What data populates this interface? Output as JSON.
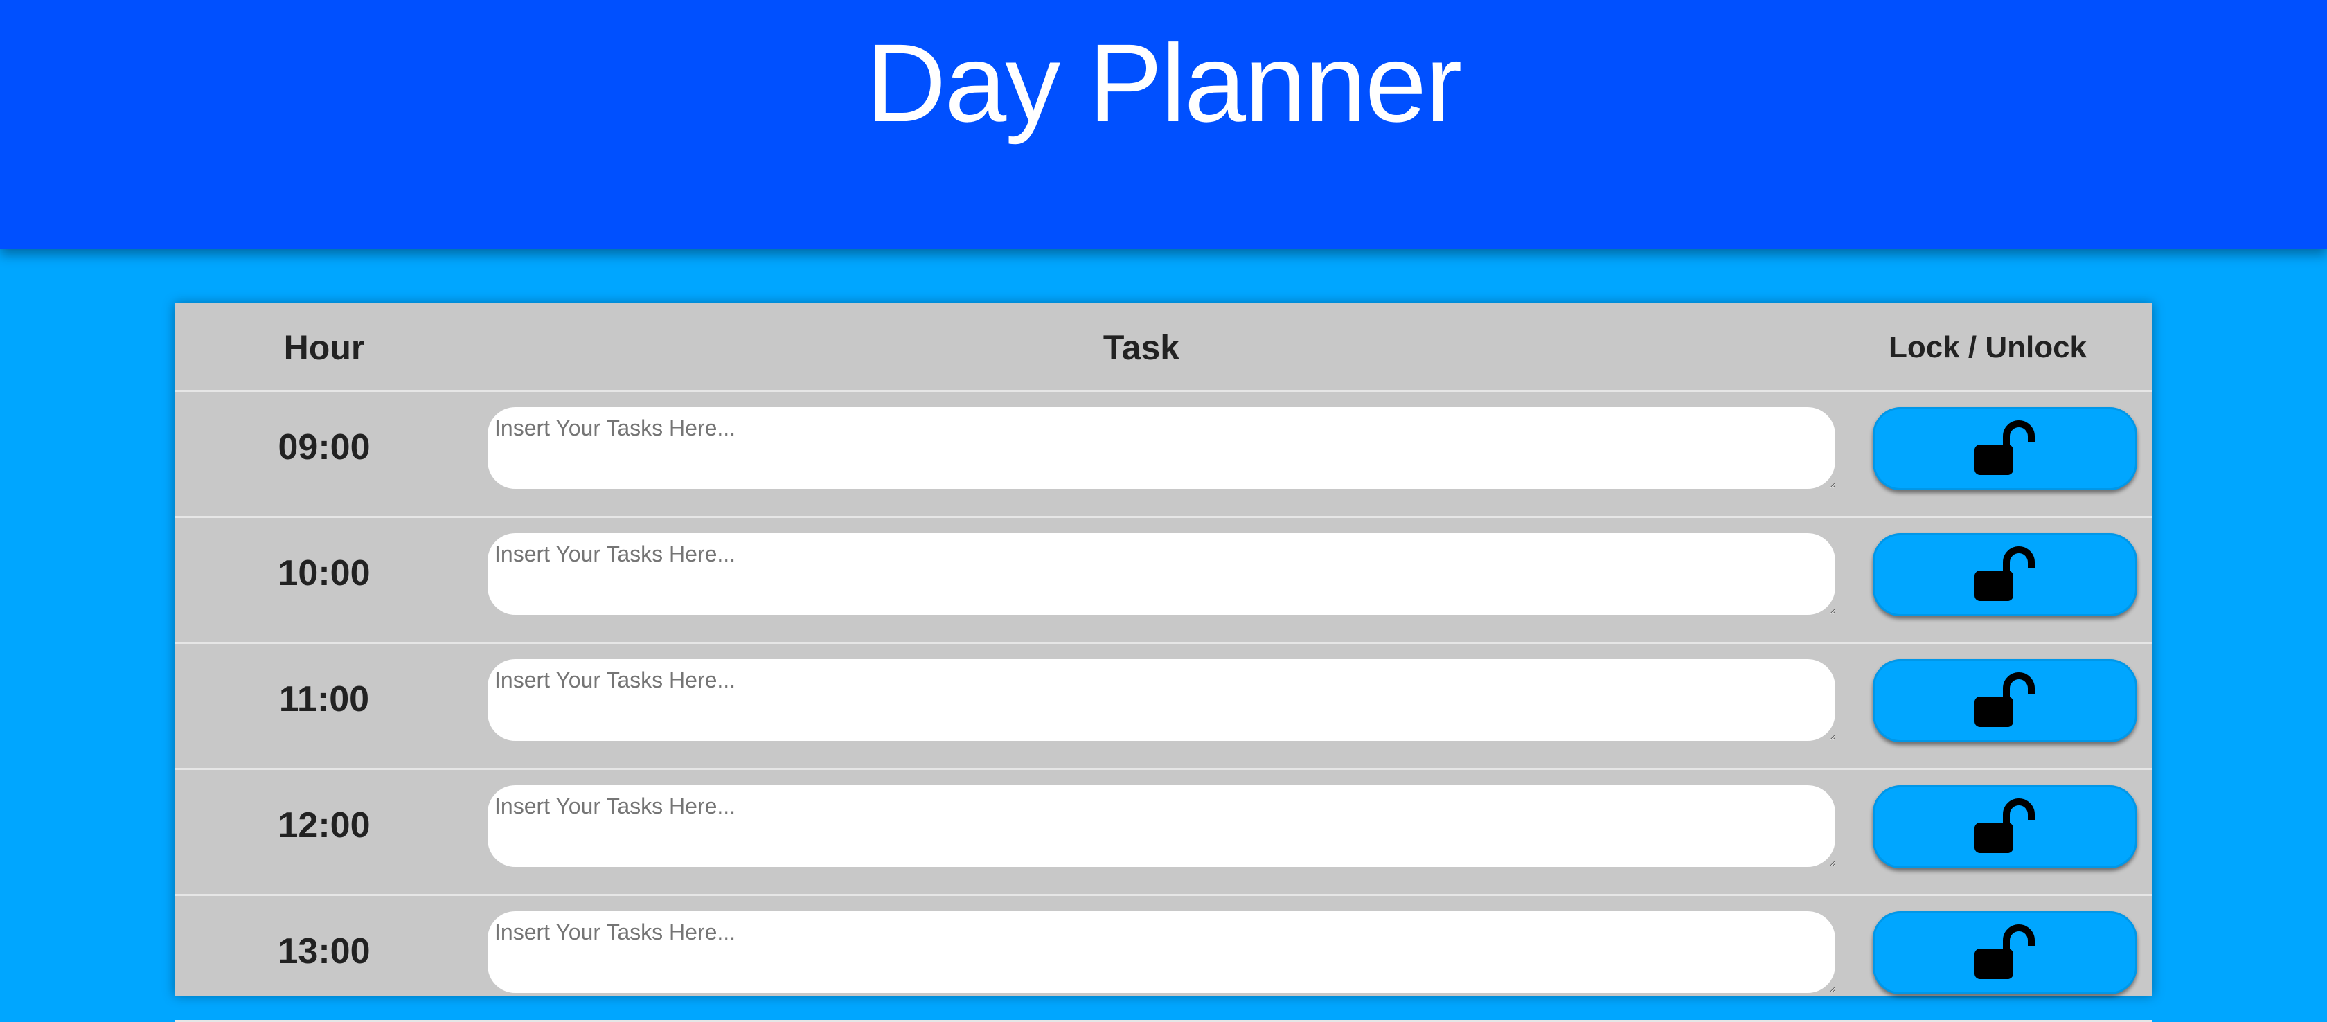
{
  "header": {
    "title": "Day Planner"
  },
  "table": {
    "columns": {
      "hour": "Hour",
      "task": "Task",
      "lock": "Lock / Unlock"
    },
    "task_placeholder": "Insert Your Tasks Here...",
    "rows": [
      {
        "hour": "09:00",
        "task": "",
        "lock_icon": "unlock-icon"
      },
      {
        "hour": "10:00",
        "task": "",
        "lock_icon": "unlock-icon"
      },
      {
        "hour": "11:00",
        "task": "",
        "lock_icon": "unlock-icon"
      },
      {
        "hour": "12:00",
        "task": "",
        "lock_icon": "unlock-icon"
      },
      {
        "hour": "13:00",
        "task": "",
        "lock_icon": "unlock-icon"
      }
    ]
  },
  "colors": {
    "header_bg": "#0050ff",
    "page_bg": "#00a6ff",
    "panel_bg": "#c8c8c8",
    "button_bg": "#00a6ff"
  }
}
